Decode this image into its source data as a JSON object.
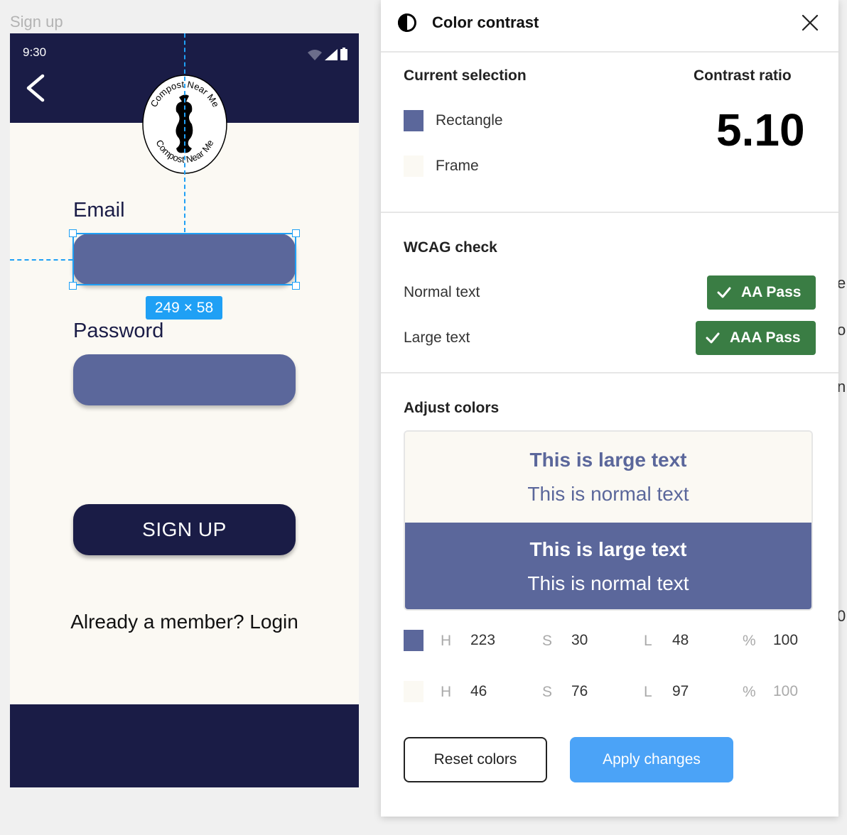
{
  "canvas": {
    "frame_label": "Sign up",
    "selection_size": "249 × 58",
    "guide_color": "#1fa0f5"
  },
  "phone": {
    "status_time": "9:30",
    "logo_text": "Compost Near Me",
    "email_label": "Email",
    "password_label": "Password",
    "signup_label": "SIGN UP",
    "member_text": "Already a member? Login",
    "colors": {
      "dark": "#1a1c46",
      "input": "#5b679b",
      "background": "#fbf9f3"
    }
  },
  "edge": {
    "letters": [
      "e",
      "o",
      "n",
      "0"
    ]
  },
  "panel": {
    "title": "Color contrast",
    "icon": "contrast-icon",
    "current_selection": {
      "heading": "Current selection",
      "layers": [
        {
          "name": "Rectangle",
          "color": "#5b679b"
        },
        {
          "name": "Frame",
          "color": "#fbf9f3"
        }
      ]
    },
    "contrast": {
      "heading": "Contrast ratio",
      "value": "5.10"
    },
    "wcag": {
      "heading": "WCAG check",
      "rows": [
        {
          "label": "Normal text",
          "result": "AA Pass"
        },
        {
          "label": "Large text",
          "result": "AAA Pass"
        }
      ],
      "pass_color": "#3a7d44"
    },
    "adjust": {
      "heading": "Adjust colors",
      "preview": {
        "large_text": "This is large text",
        "normal_text": "This is normal text"
      },
      "colors": [
        {
          "swatch": "#5b679b",
          "h_label": "H",
          "h": "223",
          "s_label": "S",
          "s": "30",
          "l_label": "L",
          "l": "48",
          "alpha_label": "%",
          "alpha": "100"
        },
        {
          "swatch": "#fbf9f3",
          "h_label": "H",
          "h": "46",
          "s_label": "S",
          "s": "76",
          "l_label": "L",
          "l": "97",
          "alpha_label": "%",
          "alpha": "100"
        }
      ]
    },
    "buttons": {
      "reset": "Reset colors",
      "apply": "Apply changes"
    }
  }
}
